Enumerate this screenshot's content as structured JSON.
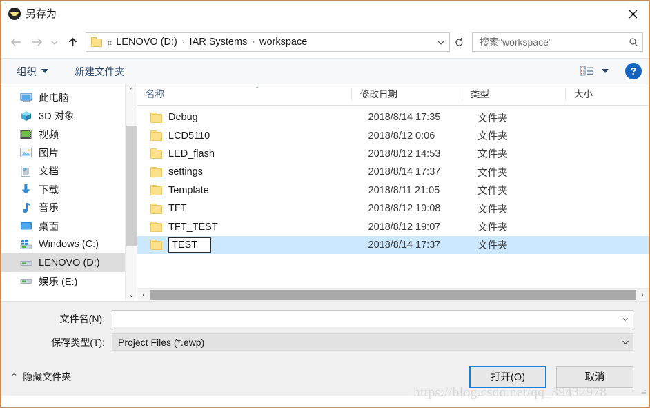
{
  "window": {
    "title": "另存为",
    "icon": "iar-workbench-icon",
    "close_label": "✕",
    "border_color": "#d08a49"
  },
  "nav": {
    "back": "back-arrow",
    "forward": "forward-arrow",
    "recent": "recent-dropdown",
    "up": "up-arrow",
    "breadcrumb": {
      "overflow": "«",
      "items": [
        "LENOVO (D:)",
        "IAR Systems",
        "workspace"
      ],
      "separator": "›"
    },
    "address_dropdown": "⌄",
    "refresh": "↻"
  },
  "search": {
    "placeholder": "搜索\"workspace\"",
    "value": "",
    "icon": "search-icon"
  },
  "commandbar": {
    "organize_label": "组织",
    "new_folder_label": "新建文件夹",
    "view_icon": "list-view-icon",
    "view_caret": "▼",
    "help_label": "?"
  },
  "sidebar": {
    "scroll": {
      "up": "⌃",
      "down": "⌄"
    },
    "items": [
      {
        "label": "此电脑",
        "icon": "monitor-icon",
        "selected": false
      },
      {
        "label": "3D 对象",
        "icon": "cube-icon",
        "selected": false
      },
      {
        "label": "视频",
        "icon": "video-icon",
        "selected": false
      },
      {
        "label": "图片",
        "icon": "picture-icon",
        "selected": false
      },
      {
        "label": "文档",
        "icon": "document-icon",
        "selected": false
      },
      {
        "label": "下载",
        "icon": "download-icon",
        "selected": false
      },
      {
        "label": "音乐",
        "icon": "music-icon",
        "selected": false
      },
      {
        "label": "桌面",
        "icon": "desktop-icon",
        "selected": false
      },
      {
        "label": "Windows (C:)",
        "icon": "windows-drive-icon",
        "selected": false
      },
      {
        "label": "LENOVO (D:)",
        "icon": "drive-icon",
        "selected": true
      },
      {
        "label": "娱乐 (E:)",
        "icon": "drive-icon",
        "selected": false
      }
    ]
  },
  "filelist": {
    "columns": [
      {
        "key": "name",
        "label": "名称"
      },
      {
        "key": "date",
        "label": "修改日期"
      },
      {
        "key": "type",
        "label": "类型"
      },
      {
        "key": "size",
        "label": "大小"
      }
    ],
    "sort_indicator": "⌃",
    "rows": [
      {
        "name": "Debug",
        "date": "2018/8/14 17:35",
        "type": "文件夹",
        "size": "",
        "selected": false,
        "renaming": false
      },
      {
        "name": "LCD5110",
        "date": "2018/8/12 0:06",
        "type": "文件夹",
        "size": "",
        "selected": false,
        "renaming": false
      },
      {
        "name": "LED_flash",
        "date": "2018/8/12 14:53",
        "type": "文件夹",
        "size": "",
        "selected": false,
        "renaming": false
      },
      {
        "name": "settings",
        "date": "2018/8/14 17:37",
        "type": "文件夹",
        "size": "",
        "selected": false,
        "renaming": false
      },
      {
        "name": "Template",
        "date": "2018/8/11 21:05",
        "type": "文件夹",
        "size": "",
        "selected": false,
        "renaming": false
      },
      {
        "name": "TFT",
        "date": "2018/8/12 19:08",
        "type": "文件夹",
        "size": "",
        "selected": false,
        "renaming": false
      },
      {
        "name": "TFT_TEST",
        "date": "2018/8/12 19:07",
        "type": "文件夹",
        "size": "",
        "selected": false,
        "renaming": false
      },
      {
        "name": "TEST",
        "date": "2018/8/14 17:37",
        "type": "文件夹",
        "size": "",
        "selected": true,
        "renaming": true
      }
    ],
    "hscroll": {
      "left": "‹",
      "right": "›"
    },
    "selection_color": "#cce8ff"
  },
  "form": {
    "filename_label": "文件名(N):",
    "filename_value": "",
    "filetype_label": "保存类型(T):",
    "filetype_value": "Project Files (*.ewp)",
    "caret": "⌄"
  },
  "footer": {
    "hide_folders_label": "隐藏文件夹",
    "hide_folders_caret": "⌃",
    "open_label": "打开(O)",
    "cancel_label": "取消",
    "accent_color": "#1a7fd4"
  },
  "watermark": {
    "text": "https://blog.csdn.net/qq_39432978"
  }
}
